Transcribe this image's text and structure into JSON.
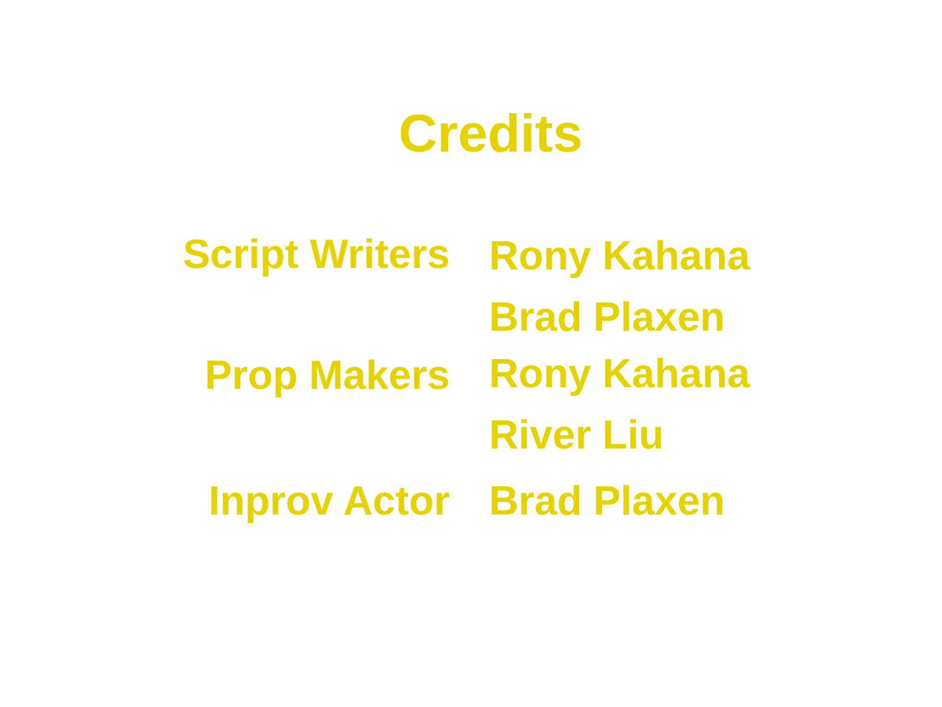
{
  "title": "Credits",
  "credits": [
    {
      "role": "Script Writers",
      "names": [
        "Rony Kahana",
        "Brad Plaxen"
      ]
    },
    {
      "role": "Prop Makers",
      "names": [
        "Rony Kahana",
        "River Liu"
      ]
    },
    {
      "role": "Inprov Actor",
      "names": [
        "Brad Plaxen"
      ]
    }
  ],
  "colors": {
    "text": "#e6d200",
    "background": "#ffffff"
  }
}
